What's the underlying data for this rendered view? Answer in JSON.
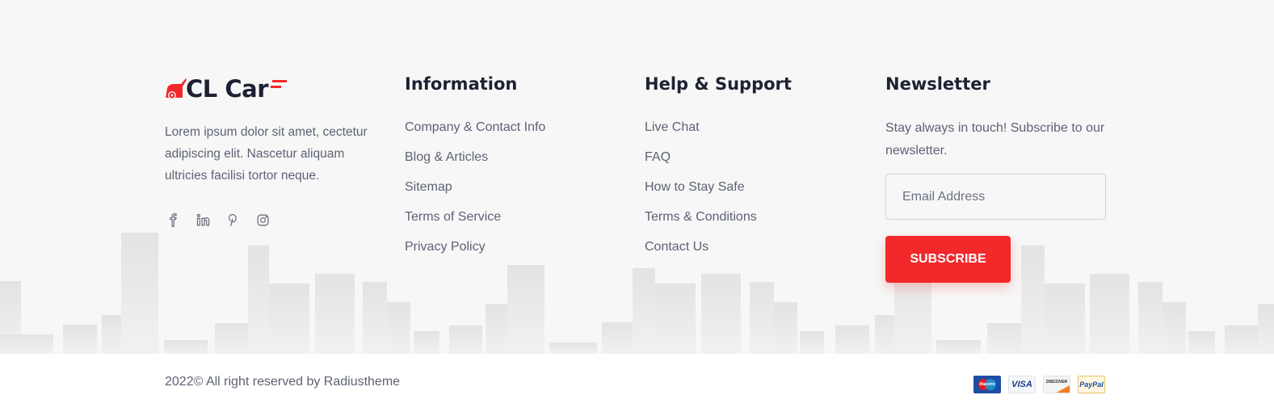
{
  "brand": {
    "logo_text": "CL Car",
    "about": "Lorem ipsum dolor sit amet, cectetur adipiscing elit. Nascetur aliquam ultricies facilisi tortor neque.",
    "accent_color": "#f2282a",
    "social": [
      "facebook-icon",
      "linkedin-icon",
      "pinterest-icon",
      "instagram-icon"
    ]
  },
  "information": {
    "title": "Information",
    "links": [
      "Company & Contact Info",
      "Blog & Articles",
      "Sitemap",
      "Terms of Service",
      "Privacy Policy"
    ]
  },
  "help": {
    "title": "Help & Support",
    "links": [
      "Live Chat",
      "FAQ",
      "How to Stay Safe",
      "Terms & Conditions",
      "Contact Us"
    ]
  },
  "newsletter": {
    "title": "Newsletter",
    "text": "Stay always in touch! Subscribe to our newsletter.",
    "email_placeholder": "Email Address",
    "button_label": "SUBSCRIBE"
  },
  "bottom": {
    "copyright": "2022© All right reserved by Radiustheme",
    "payments": {
      "maestro": "Maestro",
      "visa": "VISA",
      "discover": "DISCOVER",
      "paypal": "PayPal"
    }
  }
}
